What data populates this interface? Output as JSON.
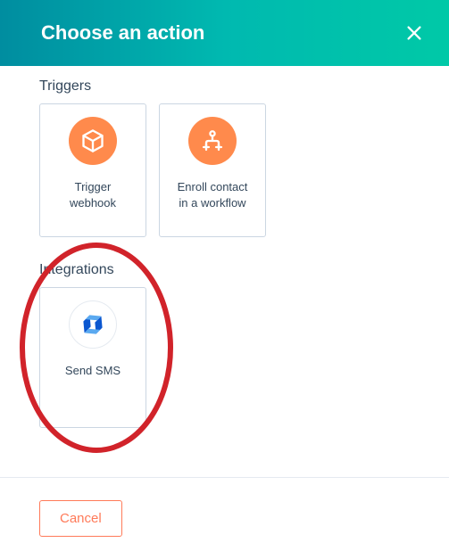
{
  "header": {
    "title": "Choose an action"
  },
  "sections": {
    "triggers": {
      "label": "Triggers",
      "items": [
        {
          "label": "Trigger\nwebhook"
        },
        {
          "label": "Enroll contact\nin a workflow"
        }
      ]
    },
    "integrations": {
      "label": "Integrations",
      "items": [
        {
          "label": "Send SMS"
        }
      ]
    }
  },
  "footer": {
    "cancel_label": "Cancel"
  }
}
